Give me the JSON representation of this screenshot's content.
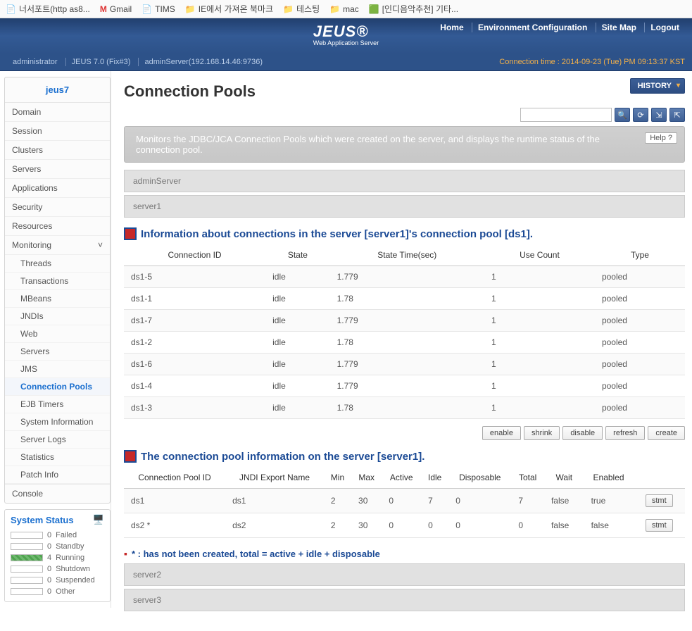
{
  "bookmarks": {
    "b0": "너서포트(http as8...",
    "b1": "Gmail",
    "b2": "TIMS",
    "b3": "IE에서 가져온 북마크",
    "b4": "테스팅",
    "b5": "mac",
    "b6": "[인디음악추천] 기타..."
  },
  "logo": {
    "main": "JEUS®",
    "sub": "Web Application Server"
  },
  "top_links": {
    "home": "Home",
    "env": "Environment Configuration",
    "sitemap": "Site Map",
    "logout": "Logout"
  },
  "subhead": {
    "user": "administrator",
    "version": "JEUS 7.0 (Fix#3)",
    "server": "adminServer(192.168.14.46:9736)",
    "ctime": "Connection time : 2014-09-23 (Tue) PM 09:13:37 KST"
  },
  "sidebar": {
    "title": "jeus7",
    "items": {
      "domain": "Domain",
      "session": "Session",
      "clusters": "Clusters",
      "servers": "Servers",
      "applications": "Applications",
      "security": "Security",
      "resources": "Resources",
      "monitoring": "Monitoring"
    },
    "mon": {
      "threads": "Threads",
      "transactions": "Transactions",
      "mbeans": "MBeans",
      "jndis": "JNDIs",
      "web": "Web",
      "servers": "Servers",
      "jms": "JMS",
      "cpools": "Connection Pools",
      "ejbtimers": "EJB Timers",
      "sysinfo": "System Information",
      "slogs": "Server Logs",
      "stats": "Statistics",
      "patch": "Patch Info"
    },
    "console": "Console"
  },
  "sys_status": {
    "title": "System Status",
    "rows": {
      "failed": {
        "n": "0",
        "l": "Failed"
      },
      "standby": {
        "n": "0",
        "l": "Standby"
      },
      "running": {
        "n": "4",
        "l": "Running"
      },
      "shutdown": {
        "n": "0",
        "l": "Shutdown"
      },
      "suspended": {
        "n": "0",
        "l": "Suspended"
      },
      "other": {
        "n": "0",
        "l": "Other"
      }
    }
  },
  "page": {
    "title": "Connection Pools",
    "history": "HISTORY",
    "desc": "Monitors the JDBC/JCA Connection Pools which were created on the server, and displays the runtime status of the connection pool.",
    "help": "Help ?",
    "gray1": "adminServer",
    "gray2": "server1",
    "h_info": "Information about connections in the server [server1]'s connection pool [ds1].",
    "cols1": {
      "cid": "Connection ID",
      "state": "State",
      "stime": "State Time(sec)",
      "uc": "Use Count",
      "type": "Type"
    },
    "rows1": [
      {
        "cid": "ds1-5",
        "state": "idle",
        "stime": "1.779",
        "uc": "1",
        "type": "pooled"
      },
      {
        "cid": "ds1-1",
        "state": "idle",
        "stime": "1.78",
        "uc": "1",
        "type": "pooled"
      },
      {
        "cid": "ds1-7",
        "state": "idle",
        "stime": "1.779",
        "uc": "1",
        "type": "pooled"
      },
      {
        "cid": "ds1-2",
        "state": "idle",
        "stime": "1.78",
        "uc": "1",
        "type": "pooled"
      },
      {
        "cid": "ds1-6",
        "state": "idle",
        "stime": "1.779",
        "uc": "1",
        "type": "pooled"
      },
      {
        "cid": "ds1-4",
        "state": "idle",
        "stime": "1.779",
        "uc": "1",
        "type": "pooled"
      },
      {
        "cid": "ds1-3",
        "state": "idle",
        "stime": "1.78",
        "uc": "1",
        "type": "pooled"
      }
    ],
    "btns": {
      "enable": "enable",
      "shrink": "shrink",
      "disable": "disable",
      "refresh": "refresh",
      "create": "create"
    },
    "h_pool": "The connection pool information on the server [server1].",
    "cols2": {
      "cpid": "Connection Pool ID",
      "jndi": "JNDI Export Name",
      "min": "Min",
      "max": "Max",
      "active": "Active",
      "idle": "Idle",
      "disp": "Disposable",
      "total": "Total",
      "wait": "Wait",
      "enabled": "Enabled",
      "act": ""
    },
    "rows2": [
      {
        "cpid": "ds1",
        "jndi": "ds1",
        "min": "2",
        "max": "30",
        "active": "0",
        "idle": "7",
        "disp": "0",
        "total": "7",
        "wait": "false",
        "enabled": "true",
        "act": "stmt"
      },
      {
        "cpid": "ds2 *",
        "jndi": "ds2",
        "min": "2",
        "max": "30",
        "active": "0",
        "idle": "0",
        "disp": "0",
        "total": "0",
        "wait": "false",
        "enabled": "false",
        "act": "stmt"
      }
    ],
    "footnote": "* : has not been created, total = active + idle + disposable",
    "gray3": "server2",
    "gray4": "server3"
  }
}
